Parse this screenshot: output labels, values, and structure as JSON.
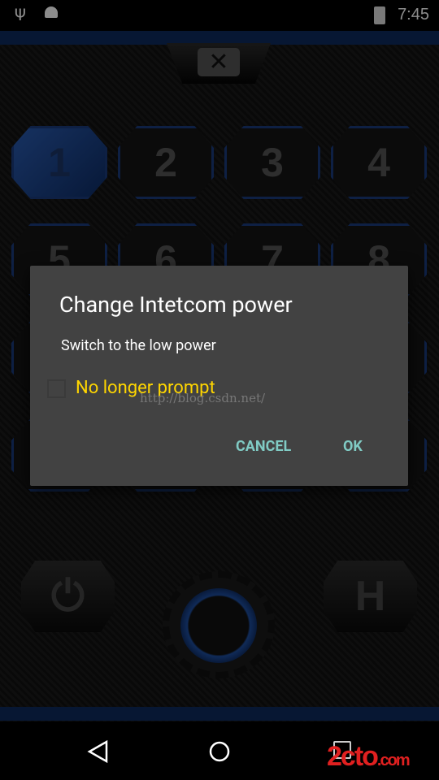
{
  "status_bar": {
    "time": "7:45",
    "icons": [
      "usb-icon",
      "android-debug-icon",
      "battery-charging-icon"
    ]
  },
  "app": {
    "channels": [
      "1",
      "2",
      "3",
      "4",
      "5",
      "6",
      "7",
      "8"
    ],
    "active_channel": "1",
    "power_icon": "power-icon",
    "h_label": "H",
    "accent_color": "#1b3b7c"
  },
  "dialog": {
    "title": "Change Intetcom power",
    "message": "Switch to the low power",
    "checkbox_label": "No longer prompt",
    "checkbox_checked": false,
    "watermark": "http://blog.csdn.net/",
    "cancel": "CANCEL",
    "ok": "OK"
  },
  "nav": {
    "logo": "2cto.com"
  }
}
